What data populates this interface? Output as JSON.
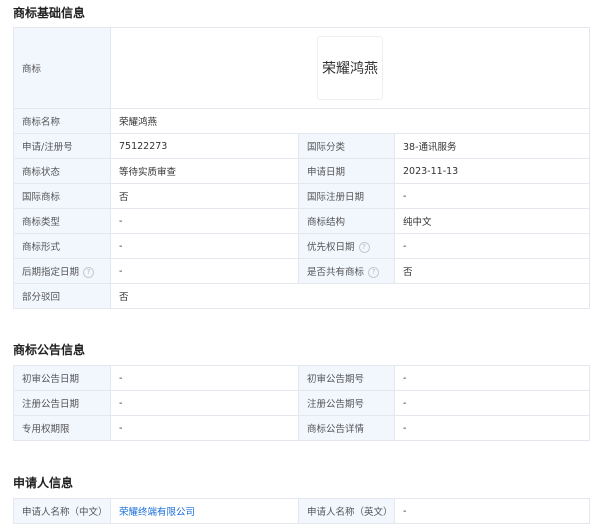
{
  "sections": {
    "basic_title": "商标基础信息",
    "notice_title": "商标公告信息",
    "applicant_title": "申请人信息"
  },
  "basic": {
    "trademark_label": "商标",
    "trademark_image_text": "荣耀鸿燕",
    "name_label": "商标名称",
    "name_value": "荣耀鸿燕",
    "reg_no_label": "申请/注册号",
    "reg_no_value": "75122273",
    "intl_class_label": "国际分类",
    "intl_class_value": "38-通讯服务",
    "status_label": "商标状态",
    "status_value": "等待实质审查",
    "apply_date_label": "申请日期",
    "apply_date_value": "2023-11-13",
    "intl_tm_label": "国际商标",
    "intl_tm_value": "否",
    "intl_reg_date_label": "国际注册日期",
    "intl_reg_date_value": "-",
    "tm_type_label": "商标类型",
    "tm_type_value": "-",
    "tm_structure_label": "商标结构",
    "tm_structure_value": "纯中文",
    "tm_form_label": "商标形式",
    "tm_form_value": "-",
    "priority_date_label": "优先权日期",
    "priority_date_value": "-",
    "later_date_label": "后期指定日期",
    "later_date_value": "-",
    "shared_label": "是否共有商标",
    "shared_value": "否",
    "partial_reject_label": "部分驳回",
    "partial_reject_value": "否",
    "help_glyph": "?"
  },
  "notice": {
    "prelim_date_label": "初审公告日期",
    "prelim_date_value": "-",
    "prelim_issue_label": "初审公告期号",
    "prelim_issue_value": "-",
    "reg_date_label": "注册公告日期",
    "reg_date_value": "-",
    "reg_issue_label": "注册公告期号",
    "reg_issue_value": "-",
    "exclusive_label": "专用权期限",
    "exclusive_value": "-",
    "detail_label": "商标公告详情",
    "detail_value": "-"
  },
  "applicant": {
    "name_cn_label": "申请人名称（中文）",
    "name_cn_value": "荣耀终端有限公司",
    "name_en_label": "申请人名称（英文）",
    "name_en_value": "-"
  },
  "colors": {
    "label_bg": "#f2f7fe",
    "border": "#e4e8ee",
    "link": "#1a6fd8"
  }
}
